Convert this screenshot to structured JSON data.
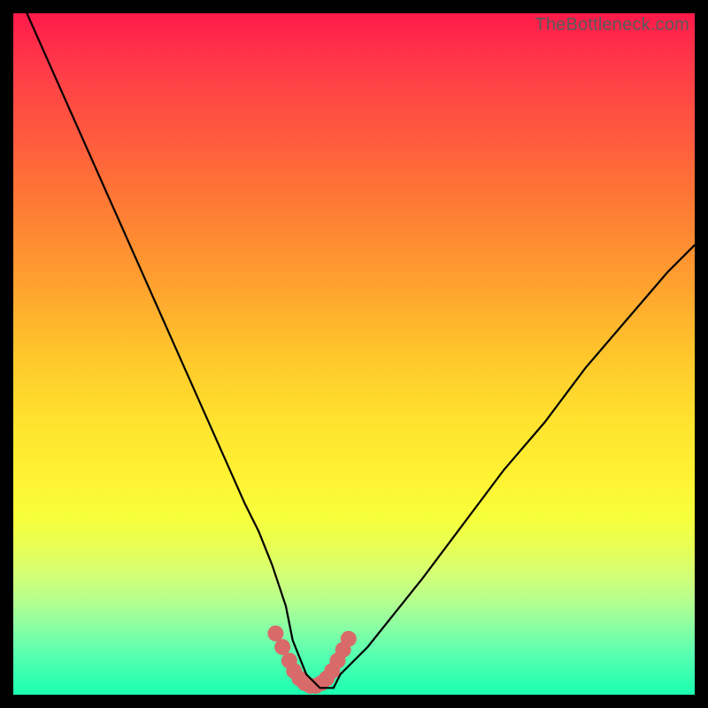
{
  "watermark": {
    "text": "TheBottleneck.com"
  },
  "chart_data": {
    "type": "line",
    "title": "",
    "xlabel": "",
    "ylabel": "",
    "xlim": [
      0,
      100
    ],
    "ylim": [
      0,
      100
    ],
    "series": [
      {
        "name": "main-curve",
        "x": [
          2,
          6,
          10,
          14,
          18,
          22,
          26,
          30,
          34,
          36,
          38,
          40,
          41,
          43,
          45,
          47,
          48,
          52,
          56,
          60,
          66,
          72,
          78,
          84,
          90,
          96,
          100
        ],
        "values": [
          100,
          91,
          82,
          73,
          64,
          55,
          46,
          37,
          28,
          24,
          19,
          13,
          8,
          3,
          1,
          1,
          3,
          7,
          12,
          17,
          25,
          33,
          40,
          48,
          55,
          62,
          66
        ]
      },
      {
        "name": "highlight-dots",
        "x": [
          38.5,
          39.5,
          40.5,
          41.2,
          42.0,
          42.8,
          43.6,
          44.4,
          45.2,
          46.0,
          46.8,
          47.6,
          48.4,
          49.2
        ],
        "values": [
          9.0,
          7.0,
          5.0,
          3.5,
          2.4,
          1.7,
          1.3,
          1.3,
          1.7,
          2.4,
          3.5,
          5.0,
          6.6,
          8.2
        ]
      }
    ],
    "colors": {
      "curve": "#000000",
      "dots": "#d96a6a",
      "gradient_top": "#ff1a4a",
      "gradient_bottom": "#1affb0"
    }
  }
}
